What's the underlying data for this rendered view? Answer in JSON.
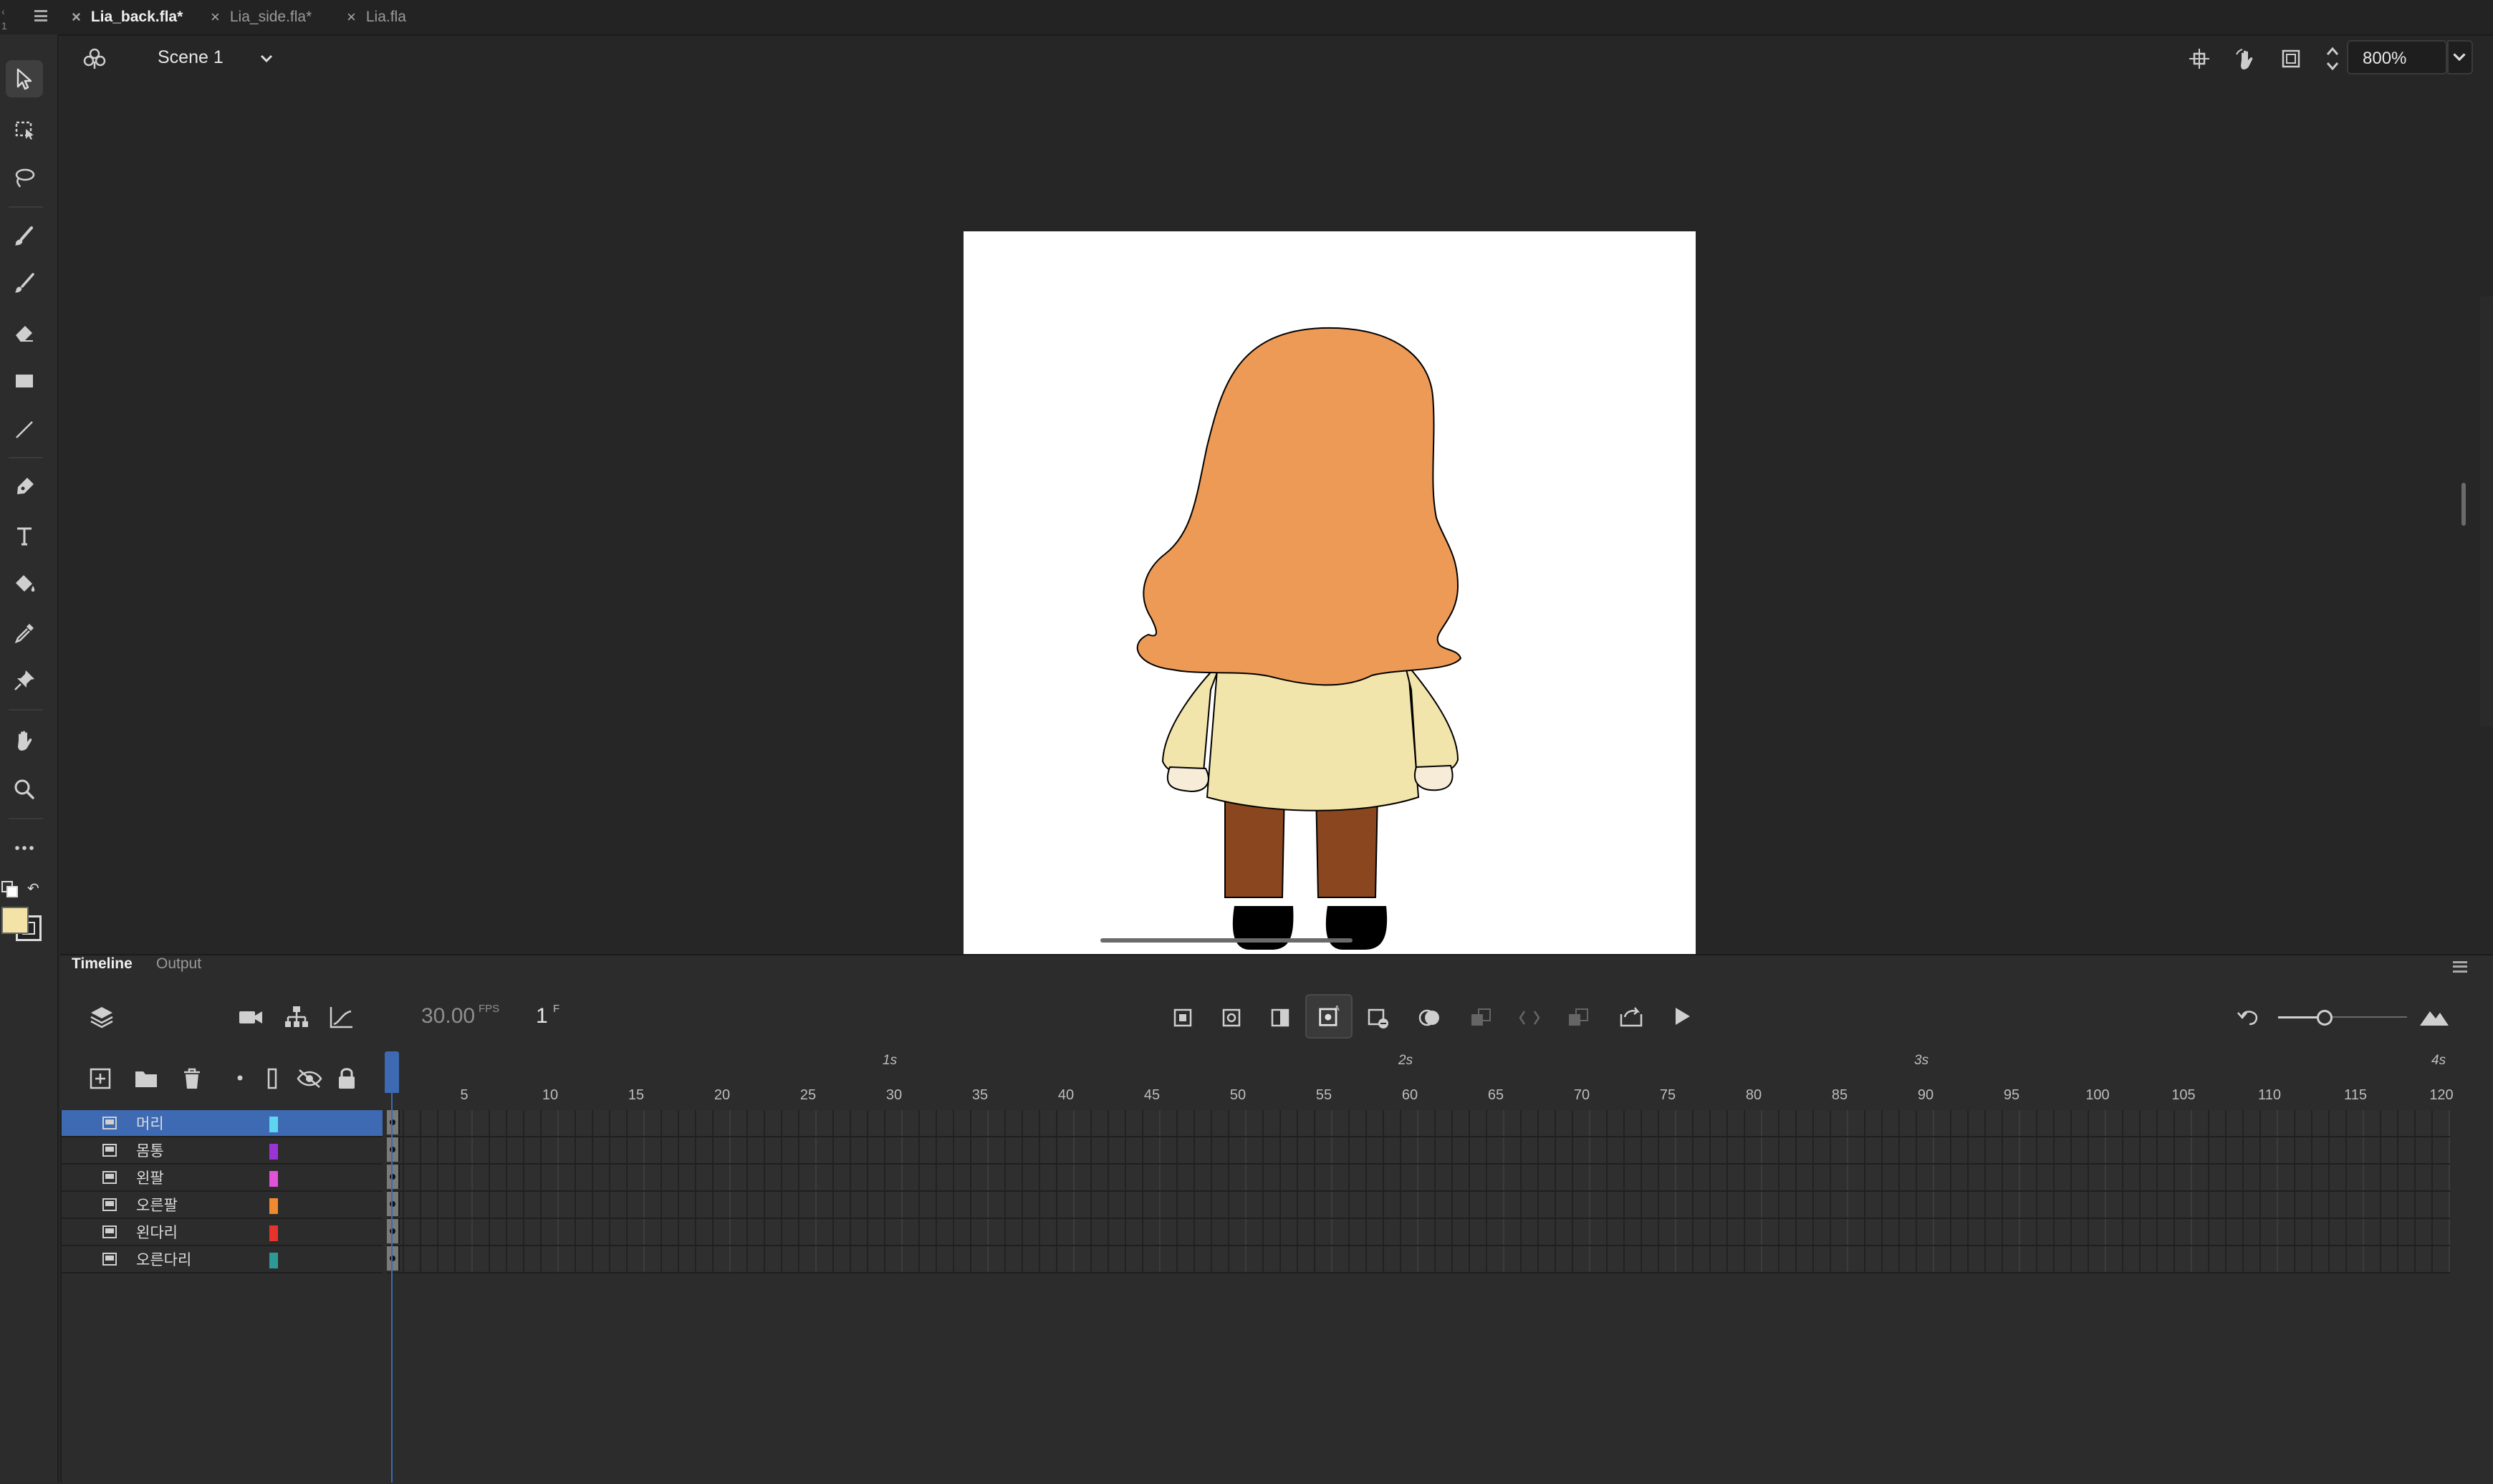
{
  "tabs": [
    {
      "label": "Lia_back.fla*",
      "active": true
    },
    {
      "label": "Lia_side.fla*",
      "active": false
    },
    {
      "label": "Lia.fla",
      "active": false
    }
  ],
  "scene": {
    "label": "Scene 1"
  },
  "zoom": {
    "value": "800%"
  },
  "panels": {
    "timeline": "Timeline",
    "output": "Output"
  },
  "timeline": {
    "fps": "30.00",
    "fps_unit": "FPS",
    "frame": "1",
    "frame_unit": "F",
    "seconds": [
      "1s",
      "2s",
      "3s",
      "4s"
    ],
    "ruler": [
      "5",
      "10",
      "15",
      "20",
      "25",
      "30",
      "35",
      "40",
      "45",
      "50",
      "55",
      "60",
      "65",
      "70",
      "75",
      "80",
      "85",
      "90",
      "95",
      "100",
      "105",
      "110",
      "115",
      "120"
    ]
  },
  "layers": [
    {
      "name": "머리",
      "color": "#5fd6f0",
      "selected": true
    },
    {
      "name": "몸통",
      "color": "#9b34d4",
      "selected": false
    },
    {
      "name": "왼팔",
      "color": "#e052d8",
      "selected": false
    },
    {
      "name": "오른팔",
      "color": "#ef8a2f",
      "selected": false
    },
    {
      "name": "왼다리",
      "color": "#e8332d",
      "selected": false
    },
    {
      "name": "오른다리",
      "color": "#2e9a98",
      "selected": false
    }
  ],
  "colors": {
    "fill": "#f4e3a6",
    "hair": "#ed9a57",
    "sweater": "#f2e5ab",
    "pants": "#8a461f",
    "shoes": "#000000",
    "accent": "#3d6ab3"
  },
  "icons": [
    "select-icon",
    "free-transform-icon",
    "lasso-icon",
    "paint-brush-icon",
    "brush-icon",
    "eraser-icon",
    "rectangle-icon",
    "line-icon",
    "pen-icon",
    "text-icon",
    "paint-bucket-icon",
    "eyedropper-icon",
    "pin-icon",
    "hand-icon",
    "zoom-icon",
    "more-icon"
  ]
}
